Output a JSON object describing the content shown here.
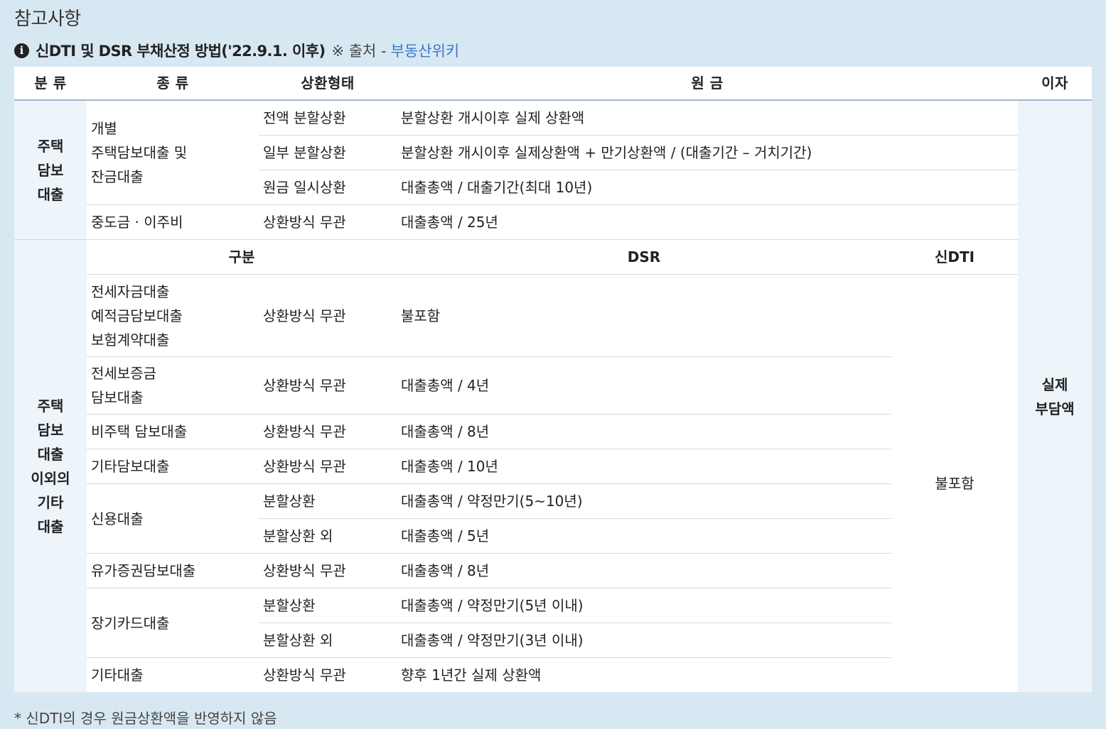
{
  "section_title": "참고사항",
  "subheading": {
    "icon": "info-icon",
    "title": "신DTI 및 DSR 부채산정 방법('22.9.1. 이후)",
    "source_prefix": "※ 출처 -",
    "source_link": "부동산위키"
  },
  "table": {
    "headers": {
      "category": "분 류",
      "type": "종 류",
      "repayment": "상환형태",
      "principal": "원 금",
      "interest": "이자"
    },
    "housing": {
      "category": "주택\n담보\n대출",
      "individual_type": "개별\n주택담보대출 및\n잔금대출",
      "rows": [
        {
          "repayment": "전액 분할상환",
          "principal": "분할상환 개시이후 실제 상환액"
        },
        {
          "repayment": "일부 분할상환",
          "principal": "분할상환 개시이후 실제상환액 + 만기상환액 / (대출기간 – 거치기간)"
        },
        {
          "repayment": "원금 일시상환",
          "principal": "대출총액 / 대출기간(최대 10년)"
        }
      ],
      "midpay": {
        "type": "중도금 · 이주비",
        "repayment": "상환방식 무관",
        "principal": "대출총액 / 25년"
      }
    },
    "other": {
      "category": "주택\n담보\n대출\n이외의\n기타\n대출",
      "subheaders": {
        "division": "구분",
        "dsr": "DSR",
        "new_dti": "신DTI"
      },
      "new_dti_value": "불포함",
      "rows": [
        {
          "type": "전세자금대출\n예적금담보대출\n보험계약대출",
          "repayment": "상환방식 무관",
          "dsr": "불포함"
        },
        {
          "type": "전세보증금\n담보대출",
          "repayment": "상환방식 무관",
          "dsr": "대출총액 / 4년"
        },
        {
          "type": "비주택 담보대출",
          "repayment": "상환방식 무관",
          "dsr": "대출총액 / 8년"
        },
        {
          "type": "기타담보대출",
          "repayment": "상환방식 무관",
          "dsr": "대출총액 / 10년"
        },
        {
          "type": "신용대출",
          "repayment": "분할상환",
          "dsr": "대출총액 / 약정만기(5~10년)"
        },
        {
          "repayment": "분할상환 외",
          "dsr": "대출총액 / 5년"
        },
        {
          "type": "유가증권담보대출",
          "repayment": "상환방식 무관",
          "dsr": "대출총액 / 8년"
        },
        {
          "type": "장기카드대출",
          "repayment": "분할상환",
          "dsr": "대출총액 / 약정만기(5년 이내)"
        },
        {
          "repayment": "분할상환 외",
          "dsr": "대출총액 / 약정만기(3년 이내)"
        },
        {
          "type": "기타대출",
          "repayment": "상환방식 무관",
          "dsr": "향후 1년간 실제 상환액"
        }
      ]
    },
    "interest_value": "실제\n부담액"
  },
  "footnote": "* 신DTI의 경우 원금상환액을 반영하지 않음"
}
